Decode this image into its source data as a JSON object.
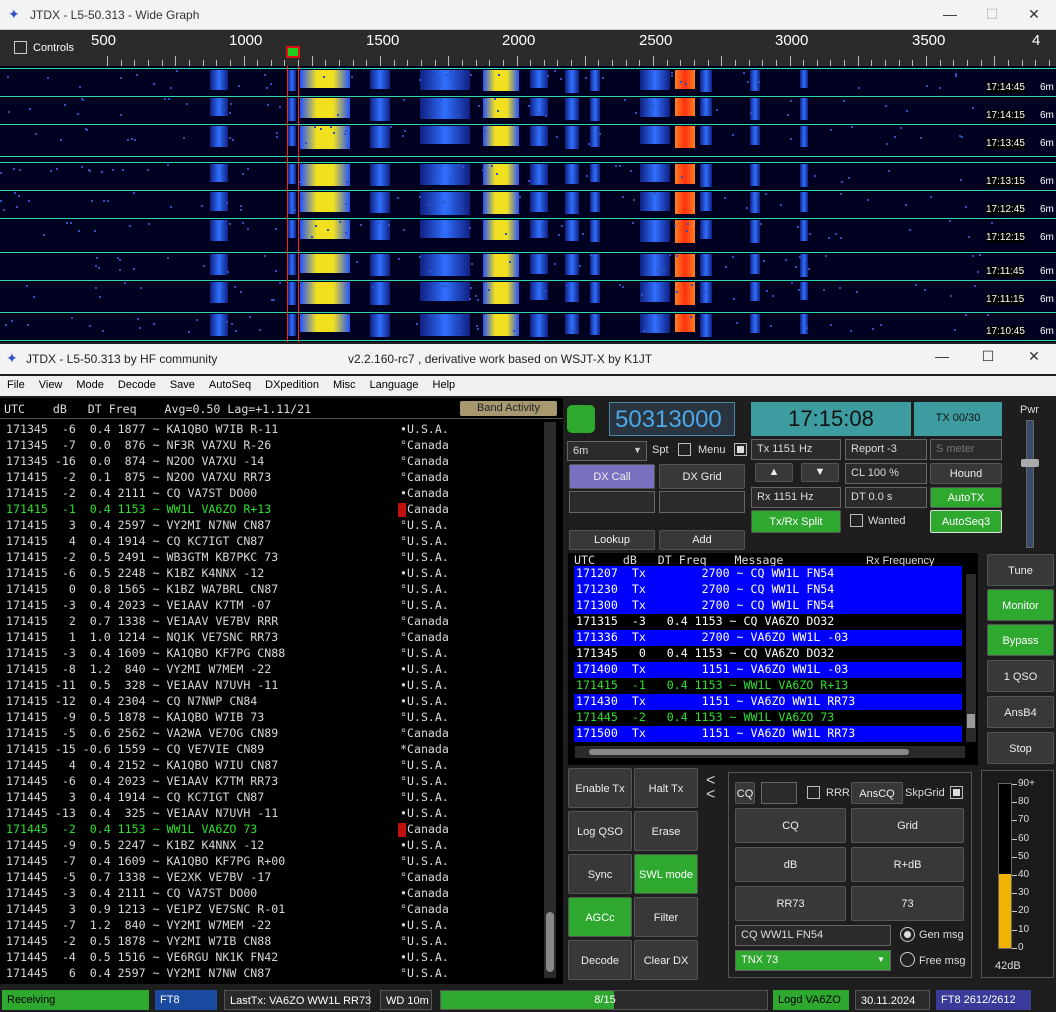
{
  "wide_graph": {
    "title": "JTDX - L5-50.313 - Wide Graph",
    "controls_label": "Controls",
    "scale": [
      "500",
      "1000",
      "1500",
      "2000",
      "2500",
      "3000",
      "3500",
      "4"
    ],
    "timestamps": [
      {
        "t": "17:14:45",
        "b": "6m"
      },
      {
        "t": "17:14:15",
        "b": "6m"
      },
      {
        "t": "17:13:45",
        "b": "6m"
      },
      {
        "t": "17:13:15",
        "b": "6m"
      },
      {
        "t": "17:12:45",
        "b": "6m"
      },
      {
        "t": "17:12:15",
        "b": "6m"
      },
      {
        "t": "17:11:45",
        "b": "6m"
      },
      {
        "t": "17:11:15",
        "b": "6m"
      },
      {
        "t": "17:10:45",
        "b": "6m"
      }
    ]
  },
  "main": {
    "title_left": "JTDX - L5-50.313  by HF community",
    "title_center": "v2.2.160-rc7 , derivative work based on WSJT-X by K1JT",
    "menu": [
      "File",
      "View",
      "Mode",
      "Decode",
      "Save",
      "AutoSeq",
      "DXpedition",
      "Misc",
      "Language",
      "Help"
    ]
  },
  "band_activity": {
    "header": "UTC    dB   DT Freq    Avg=0.50 Lag=+1.11/21",
    "button": "Band Activity",
    "rows": [
      {
        "text": "171345  -6  0.4 1877 ~ KA1QBO W7IB R-11        ",
        "country": "•U.S.A.",
        "hl": false,
        "flag": false
      },
      {
        "text": "171345  -7  0.0  876 ~ NF3R VA7XU R-26         ",
        "country": "°Canada",
        "hl": false,
        "flag": false
      },
      {
        "text": "171345 -16  0.0  874 ~ N2OO VA7XU -14          ",
        "country": "°Canada",
        "hl": false,
        "flag": false
      },
      {
        "text": "171415  -2  0.1  875 ~ N2OO VA7XU RR73         ",
        "country": "°Canada",
        "hl": false,
        "flag": false
      },
      {
        "text": "171415  -2  0.4 2111 ~ CQ VA7ST DO00           ",
        "country": "•Canada",
        "hl": false,
        "flag": false
      },
      {
        "text": "171415  -1  0.4 1153 ~ WW1L VA6ZO R+13         ",
        "country": "Canada",
        "hl": true,
        "flag": true
      },
      {
        "text": "171415   3  0.4 2597 ~ VY2MI N7NW CN87         ",
        "country": "°U.S.A.",
        "hl": false,
        "flag": false
      },
      {
        "text": "171415   4  0.4 1914 ~ CQ KC7IGT CN87          ",
        "country": "°U.S.A.",
        "hl": false,
        "flag": false
      },
      {
        "text": "171415  -2  0.5 2491 ~ WB3GTM KB7PKC 73        ",
        "country": "°U.S.A.",
        "hl": false,
        "flag": false
      },
      {
        "text": "171415  -6  0.5 2248 ~ K1BZ K4NNX -12          ",
        "country": "•U.S.A.",
        "hl": false,
        "flag": false
      },
      {
        "text": "171415   0  0.8 1565 ~ K1BZ WA7BRL CN87        ",
        "country": "°U.S.A.",
        "hl": false,
        "flag": false
      },
      {
        "text": "171415  -3  0.4 2023 ~ VE1AAV K7TM -07         ",
        "country": "°U.S.A.",
        "hl": false,
        "flag": false
      },
      {
        "text": "171415   2  0.7 1338 ~ VE1AAV VE7BV RRR        ",
        "country": "°Canada",
        "hl": false,
        "flag": false
      },
      {
        "text": "171415   1  1.0 1214 ~ NQ1K VE7SNC RR73        ",
        "country": "°Canada",
        "hl": false,
        "flag": false
      },
      {
        "text": "171415  -3  0.4 1609 ~ KA1QBO KF7PG CN88       ",
        "country": "°U.S.A.",
        "hl": false,
        "flag": false
      },
      {
        "text": "171415  -8  1.2  840 ~ VY2MI W7MEM -22         ",
        "country": "•U.S.A.",
        "hl": false,
        "flag": false
      },
      {
        "text": "171415 -11  0.5  328 ~ VE1AAV N7UVH -11        ",
        "country": "•U.S.A.",
        "hl": false,
        "flag": false
      },
      {
        "text": "171415 -12  0.4 2304 ~ CQ N7NWP CN84           ",
        "country": "•U.S.A.",
        "hl": false,
        "flag": false
      },
      {
        "text": "171415  -9  0.5 1878 ~ KA1QBO W7IB 73          ",
        "country": "°U.S.A.",
        "hl": false,
        "flag": false
      },
      {
        "text": "171415  -5  0.6 2562 ~ VA2WA VE7OG CN89        ",
        "country": "°Canada",
        "hl": false,
        "flag": false
      },
      {
        "text": "171415 -15 -0.6 1559 ~ CQ VE7VIE CN89          ",
        "country": "*Canada",
        "hl": false,
        "flag": false
      },
      {
        "text": "171445   4  0.4 2152 ~ KA1QBO W7IU CN87        ",
        "country": "°U.S.A.",
        "hl": false,
        "flag": false
      },
      {
        "text": "171445  -6  0.4 2023 ~ VE1AAV K7TM RR73        ",
        "country": "°U.S.A.",
        "hl": false,
        "flag": false
      },
      {
        "text": "171445   3  0.4 1914 ~ CQ KC7IGT CN87          ",
        "country": "°U.S.A.",
        "hl": false,
        "flag": false
      },
      {
        "text": "171445 -13  0.4  325 ~ VE1AAV N7UVH -11        ",
        "country": "•U.S.A.",
        "hl": false,
        "flag": false
      },
      {
        "text": "171445  -2  0.4 1153 ~ WW1L VA6ZO 73           ",
        "country": "Canada",
        "hl": true,
        "flag": true
      },
      {
        "text": "171445  -9  0.5 2247 ~ K1BZ K4NNX -12          ",
        "country": "•U.S.A.",
        "hl": false,
        "flag": false
      },
      {
        "text": "171445  -7  0.4 1609 ~ KA1QBO KF7PG R+00       ",
        "country": "°U.S.A.",
        "hl": false,
        "flag": false
      },
      {
        "text": "171445  -5  0.7 1338 ~ VE2XK VE7BV -17         ",
        "country": "°Canada",
        "hl": false,
        "flag": false
      },
      {
        "text": "171445  -3  0.4 2111 ~ CQ VA7ST DO00           ",
        "country": "•Canada",
        "hl": false,
        "flag": false
      },
      {
        "text": "171445   3  0.9 1213 ~ VE1PZ VE7SNC R-01       ",
        "country": "°Canada",
        "hl": false,
        "flag": false
      },
      {
        "text": "171445  -7  1.2  840 ~ VY2MI W7MEM -22         ",
        "country": "•U.S.A.",
        "hl": false,
        "flag": false
      },
      {
        "text": "171445  -2  0.5 1878 ~ VY2MI W7IB CN88         ",
        "country": "°U.S.A.",
        "hl": false,
        "flag": false
      },
      {
        "text": "171445  -4  0.5 1516 ~ VE6RGU NK1K FN42        ",
        "country": "•U.S.A.",
        "hl": false,
        "flag": false
      },
      {
        "text": "171445   6  0.4 2597 ~ VY2MI N7NW CN87         ",
        "country": "°U.S.A.",
        "hl": false,
        "flag": false
      }
    ]
  },
  "controls": {
    "frequency": "50313000",
    "band": "6m",
    "spt_label": "Spt",
    "menu_label": "Menu",
    "clock": "17:15:08",
    "tx_counter": "TX 00/30",
    "pwr_label": "Pwr",
    "tx_hz": "Tx  1151 Hz",
    "rx_hz": "Rx  1151 Hz",
    "report": "Report -3",
    "s_meter": "S meter",
    "cl": "CL  100 %",
    "dt": "DT 0.0 s",
    "hound": "Hound",
    "autotx": "AutoTX",
    "autoseq": "AutoSeq3",
    "txrx_split": "Tx/Rx Split",
    "wanted": "Wanted",
    "dx_call": "DX Call",
    "dx_grid": "DX Grid",
    "lookup": "Lookup",
    "add": "Add",
    "up": "▲",
    "down": "▼"
  },
  "rx_frequency": {
    "header": "UTC    dB   DT Freq    Message",
    "header_right": "Rx Frequency",
    "rows": [
      {
        "text": "171207  Tx        2700 ~ CQ WW1L FN54",
        "tx": true,
        "green": false
      },
      {
        "text": "171230  Tx        2700 ~ CQ WW1L FN54",
        "tx": true,
        "green": false
      },
      {
        "text": "171300  Tx        2700 ~ CQ WW1L FN54",
        "tx": true,
        "green": false
      },
      {
        "text": "171315  -3   0.4 1153 ~ CQ VA6ZO DO32",
        "tx": false,
        "green": false
      },
      {
        "text": "171336  Tx        2700 ~ VA6ZO WW1L -03",
        "tx": true,
        "green": false
      },
      {
        "text": "171345   0   0.4 1153 ~ CQ VA6ZO DO32",
        "tx": false,
        "green": false
      },
      {
        "text": "171400  Tx        1151 ~ VA6ZO WW1L -03",
        "tx": true,
        "green": false
      },
      {
        "text": "171415  -1   0.4 1153 ~ WW1L VA6ZO R+13",
        "tx": false,
        "green": true
      },
      {
        "text": "171430  Tx        1151 ~ VA6ZO WW1L RR73",
        "tx": true,
        "green": false
      },
      {
        "text": "171445  -2   0.4 1153 ~ WW1L VA6ZO 73",
        "tx": false,
        "green": true
      },
      {
        "text": "171500  Tx        1151 ~ VA6ZO WW1L RR73",
        "tx": true,
        "green": false
      }
    ]
  },
  "right_buttons": [
    "Tune",
    "Monitor",
    "Bypass",
    "1 QSO",
    "AnsB4",
    "Stop"
  ],
  "left_buttons": [
    "Enable Tx",
    "Halt Tx",
    "Log QSO",
    "Erase",
    "Sync",
    "SWL mode",
    "AGCc",
    "Filter",
    "Decode",
    "Clear DX"
  ],
  "macros": {
    "cq_small": "CQ",
    "rrr": "RRR",
    "anscq": "AnsCQ",
    "skpgrid": "SkpGrid",
    "cq": "CQ",
    "grid": "Grid",
    "db": "dB",
    "rdb": "R+dB",
    "rr73": "RR73",
    "seventythree": "73",
    "gen_text": "CQ WW1L FN54",
    "gen_msg": "Gen msg",
    "free_text": "TNX 73",
    "free_msg": "Free msg"
  },
  "meter": {
    "labels": [
      "90+",
      "80",
      "70",
      "60",
      "50",
      "40",
      "30",
      "20",
      "10",
      "0"
    ],
    "value": "42dB",
    "level": 42
  },
  "status": {
    "receiving": "Receiving",
    "mode": "FT8",
    "last_tx": "LastTx: VA6ZO WW1L RR73",
    "wd": "WD 10m",
    "progress": "8/15",
    "progress_value": 0.53,
    "logd": "Logd VA6ZO",
    "date": "30.11.2024",
    "ft8": "FT8   2612/2612"
  },
  "colors": {
    "green": "#2ea82e",
    "tx_blue": "#0000ff",
    "highlight": "#2ce02c",
    "freq_box": "#3d9ca0"
  }
}
